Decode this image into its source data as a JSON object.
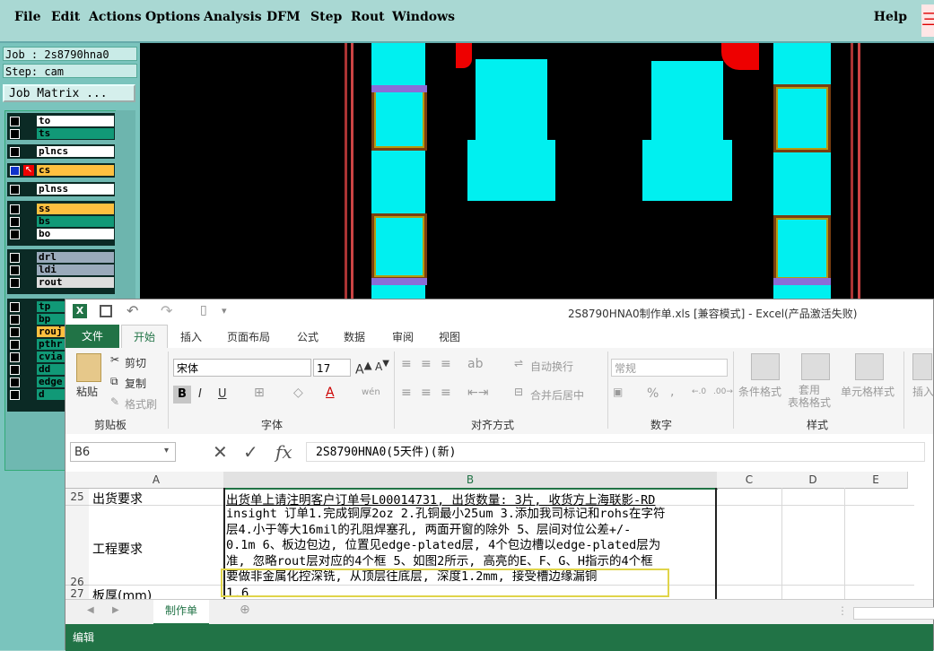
{
  "cam": {
    "menus": [
      "File",
      "Edit",
      "Actions",
      "Options",
      "Analysis",
      "DFM",
      "Step",
      "Rout",
      "Windows"
    ],
    "help": "Help",
    "job_label": "Job : 2s8790hna0",
    "step_label": "Step: cam",
    "job_matrix_button": "Job Matrix ...",
    "layers": [
      {
        "name": "to",
        "color": "#ffffff"
      },
      {
        "name": "ts",
        "color": "#119977"
      },
      {
        "name": "plncs",
        "color": "#ffffff"
      },
      {
        "name": "cs",
        "color": "#ffc040"
      },
      {
        "name": "plnss",
        "color": "#ffffff"
      },
      {
        "name": "ss",
        "color": "#ffc040"
      },
      {
        "name": "bs",
        "color": "#119977"
      },
      {
        "name": "bo",
        "color": "#ffffff"
      },
      {
        "name": "drl",
        "color": "#9aaabb"
      },
      {
        "name": "ldi",
        "color": "#9aaabb"
      },
      {
        "name": "rout",
        "color": "#dddddd"
      },
      {
        "name": "tp",
        "color": "#119977"
      },
      {
        "name": "bp",
        "color": "#119977"
      },
      {
        "name": "rouj",
        "color": "#ffc040"
      },
      {
        "name": "pthr",
        "color": "#119977"
      },
      {
        "name": "cvia",
        "color": "#119977"
      },
      {
        "name": "dd",
        "color": "#119977"
      },
      {
        "name": "edge",
        "color": "#119977"
      },
      {
        "name": "d",
        "color": "#119977"
      }
    ]
  },
  "excel": {
    "title": "2S8790HNA0制作单.xls  [兼容模式] - Excel(产品激活失败)",
    "tabs": {
      "file": "文件",
      "home": "开始",
      "insert": "插入",
      "layout": "页面布局",
      "formula": "公式",
      "data": "数据",
      "review": "审阅",
      "view": "视图"
    },
    "ribbon": {
      "paste": "粘贴",
      "cut": "剪切",
      "copy": "复制",
      "format_painter": "格式刷",
      "clipboard": "剪贴板",
      "font_name": "宋体",
      "font_size": "17",
      "font_group": "字体",
      "bold": "B",
      "italic": "I",
      "underline": "U",
      "wrap_text": "自动换行",
      "merge_center": "合并后居中",
      "alignment": "对齐方式",
      "number_format": "常规",
      "number": "数字",
      "percent": "%",
      "comma": ",",
      "cond_format": "条件格式",
      "table_format": "套用\n表格格式",
      "cell_style": "单元格样式",
      "styles": "样式",
      "insert": "插入"
    },
    "namebox": "B6",
    "formula": "2S8790HNA0(5天件)(新)",
    "columns": [
      "A",
      "B",
      "C",
      "D",
      "E"
    ],
    "rows": [
      {
        "num": "25",
        "label": "出货要求",
        "text": "出货单上请注明客户订单号L00014731, 出货数量: 3片, 收货方上海联影-RD"
      },
      {
        "num": "26",
        "label": "工程要求",
        "lines": [
          "insight 订单1.完成铜厚2oz 2.孔铜最小25um 3.添加我司标记和rohs在字符",
          "层4.小于等大16mil的孔阻焊塞孔, 两面开窗的除外  5、层间对位公差+/-",
          "0.1m  6、板边包边, 位置见edge-plated层, 4个包边槽以edge-plated层为",
          "准, 忽略rout层对应的4个框 5、如图2所示, 高亮的E、F、G、H指示的4个框",
          "要做非金属化控深铣, 从顶层往底层, 深度1.2mm, 接受槽边缘漏铜"
        ]
      },
      {
        "num": "27",
        "label": "板厚(mm)",
        "text": "1.6"
      }
    ],
    "sheet_tab": "制作单",
    "status": "编辑"
  }
}
